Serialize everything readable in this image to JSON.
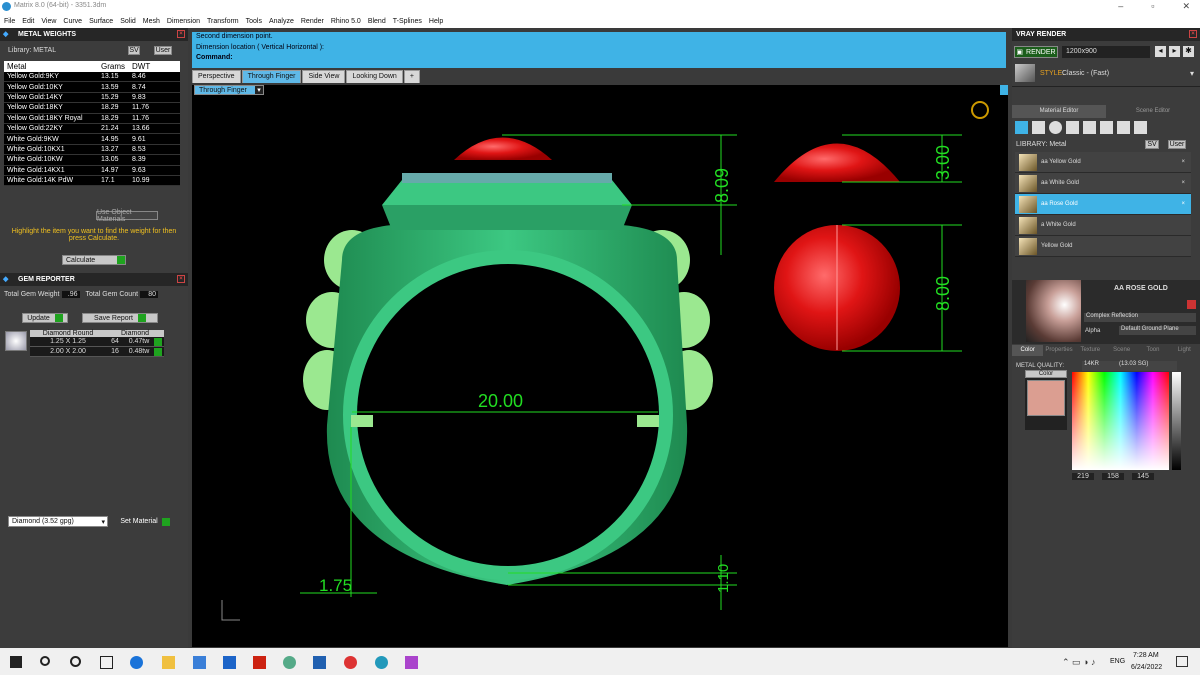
{
  "window": {
    "title": "Matrix 8.0 (64-bit) - 3351.3dm"
  },
  "menu": [
    "File",
    "Edit",
    "View",
    "Curve",
    "Surface",
    "Solid",
    "Mesh",
    "Dimension",
    "Transform",
    "Tools",
    "Analyze",
    "Render",
    "Rhino 5.0",
    "Blend",
    "T-Splines",
    "Help"
  ],
  "metal_weights": {
    "title": "METAL WEIGHTS",
    "library": "Library: METAL",
    "sv": "SV",
    "user": "User",
    "columns": [
      "Metal",
      "Grams",
      "DWT"
    ],
    "rows": [
      [
        "Yellow Gold:9KY",
        "13.15",
        "8.46"
      ],
      [
        "Yellow Gold:10KY",
        "13.59",
        "8.74"
      ],
      [
        "Yellow Gold:14KY",
        "15.29",
        "9.83"
      ],
      [
        "Yellow Gold:18KY",
        "18.29",
        "11.76"
      ],
      [
        "Yellow Gold:18KY Royal",
        "18.29",
        "11.76"
      ],
      [
        "Yellow Gold:22KY",
        "21.24",
        "13.66"
      ],
      [
        "White Gold:9KW",
        "14.95",
        "9.61"
      ],
      [
        "White Gold:10KX1",
        "13.27",
        "8.53"
      ],
      [
        "White Gold:10KW",
        "13.05",
        "8.39"
      ],
      [
        "White Gold:14KX1",
        "14.97",
        "9.63"
      ],
      [
        "White Gold:14K PdW",
        "17.1",
        "10.99"
      ]
    ],
    "use_object_materials": "Use Object Materials",
    "hint": "Highlight the item you want to find the weight for then press Calculate.",
    "calculate": "Calculate"
  },
  "gem_reporter": {
    "title": "GEM REPORTER",
    "total_weight_label": "Total Gem Weight",
    "total_weight": ".96",
    "total_count_label": "Total Gem Count",
    "total_count": "80",
    "update": "Update",
    "save_report": "Save Report",
    "col1": "Diamond Round",
    "col2": "Diamond",
    "rows": [
      [
        "1.25 X 1.25",
        "64",
        "0.47tw"
      ],
      [
        "2.00 X 2.00",
        "16",
        "0.48tw"
      ]
    ],
    "material_select": "Diamond    (3.52 gpg)",
    "set_material": "Set Material"
  },
  "command": {
    "lines": [
      "Second dimension point.",
      "Dimension location ( Vertical  Horizontal ):"
    ],
    "label": "Command:"
  },
  "view_tabs": [
    "Perspective",
    "Through Finger",
    "Side View",
    "Looking Down"
  ],
  "view_label": "Through Finger",
  "dims": {
    "height_top": "8.09",
    "gem_height": "3.00",
    "gem_width": "8.00",
    "inner_diameter": "20.00",
    "bottom": "1.10",
    "side": "1.75"
  },
  "vray": {
    "title": "VRAY RENDER",
    "render": "RENDER",
    "res": "1200x900",
    "style_label": "STYLE:",
    "style": "Classic - (Fast)",
    "tabs": [
      "Material Editor",
      "Scene Editor"
    ],
    "library": "LIBRARY: Metal",
    "sv": "SV",
    "user": "User",
    "materials": [
      "aa Yellow Gold",
      "aa White Gold",
      "aa Rose Gold",
      "a White Gold",
      "Yellow Gold"
    ],
    "selected_name": "AA ROSE GOLD",
    "complex": "Complex Reflection",
    "alpha": "Alpha",
    "ground": "Default Ground Plane",
    "subtabs": [
      "Color",
      "Properties",
      "Texture",
      "Scene",
      "Toon",
      "Light"
    ],
    "metal_quality_label": "METAL QUALITY:",
    "metal_quality": "14KR",
    "mq_value": "(13.03 SG)",
    "color_label": "Color",
    "rgb": [
      "219",
      "158",
      "145"
    ],
    "swatch": "#db9e91"
  },
  "taskbar": {
    "lang": "ENG",
    "time": "7:28 AM",
    "date": "6/24/2022"
  },
  "colors": {
    "accent": "#3fb3e6",
    "ring": "#2db56f",
    "gem": "#e01515",
    "dim": "#22dd22"
  }
}
